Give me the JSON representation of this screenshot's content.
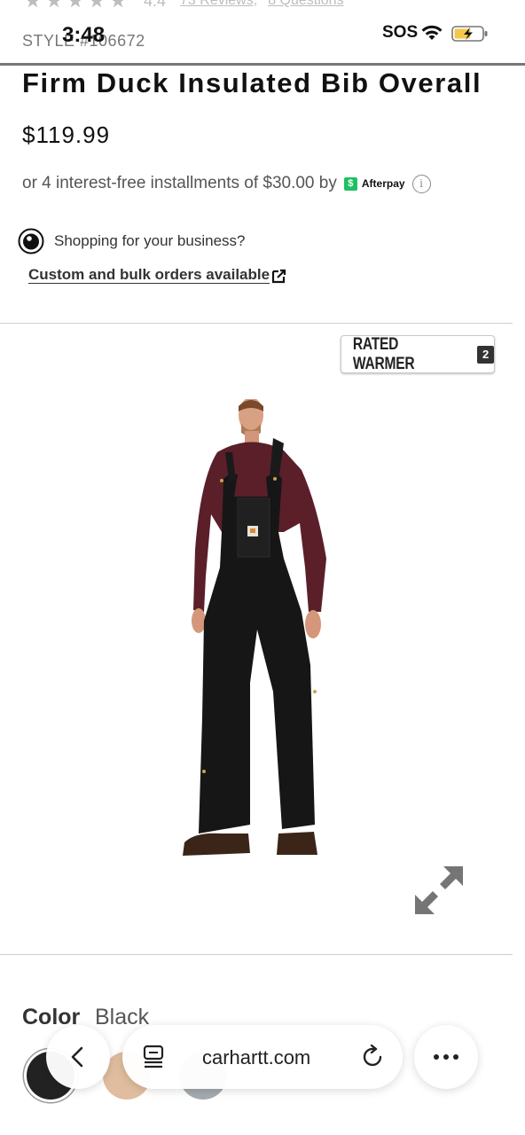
{
  "status_bar": {
    "time": "3:48",
    "sos": "SOS"
  },
  "reviews_row": {
    "rating": "4.4",
    "reviews_link": "73 Reviews,",
    "questions_link": "8 Questions"
  },
  "product": {
    "style_number": "STYLE #106672",
    "title": "Firm Duck Insulated Bib Overall",
    "price": "$119.99",
    "installments_text": "or 4 interest-free installments of $30.00 by",
    "afterpay_label": "Afterpay",
    "rated_badge_text": "RATED WARMER",
    "rated_badge_level": "2"
  },
  "business": {
    "prompt": "Shopping for your business?",
    "link_label": "Custom and bulk orders available"
  },
  "color": {
    "label": "Color",
    "value": "Black"
  },
  "browser": {
    "url": "carhartt.com"
  },
  "colors": {
    "accent_afterpay": "#20c064",
    "overall_black": "#1a1a1a",
    "shirt_maroon": "#5b1f2a"
  },
  "icons": [
    "star-icon",
    "wifi-icon",
    "battery-icon",
    "business-icon",
    "external-link-icon",
    "expand-icon",
    "back-icon",
    "reader-icon",
    "reload-icon",
    "more-icon",
    "info-icon"
  ]
}
